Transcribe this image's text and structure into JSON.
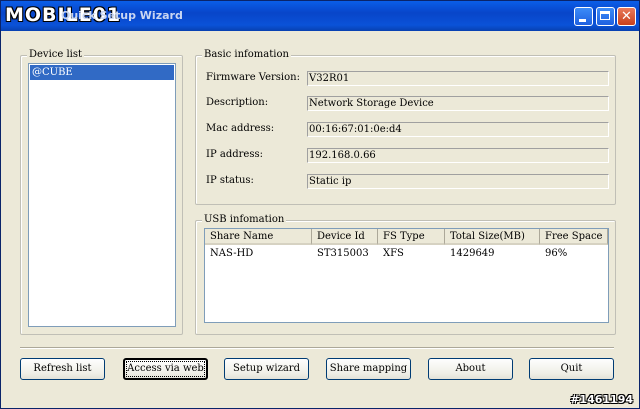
{
  "window": {
    "brand": "MOBILE01",
    "title": "Quick Setup Wizard"
  },
  "device_list": {
    "legend": "Device list",
    "items": [
      "@CUBE"
    ]
  },
  "basic_info": {
    "legend": "Basic infomation",
    "rows": [
      {
        "label": "Firmware Version:",
        "value": "V32R01"
      },
      {
        "label": "Description:",
        "value": "Network Storage Device"
      },
      {
        "label": "Mac address:",
        "value": "00:16:67:01:0e:d4"
      },
      {
        "label": "IP address:",
        "value": "192.168.0.66"
      },
      {
        "label": "IP status:",
        "value": "Static ip"
      }
    ]
  },
  "usb_info": {
    "legend": "USB infomation",
    "columns": [
      "Share Name",
      "Device Id",
      "FS Type",
      "Total Size(MB)",
      "Free Space"
    ],
    "rows": [
      [
        "NAS-HD",
        "ST315003",
        "XFS",
        "1429649",
        "96%"
      ]
    ]
  },
  "buttons": {
    "refresh": "Refresh list",
    "access": "Access via web",
    "setup": "Setup wizard",
    "share": "Share mapping",
    "about": "About",
    "quit": "Quit"
  },
  "watermark": "#1461194"
}
